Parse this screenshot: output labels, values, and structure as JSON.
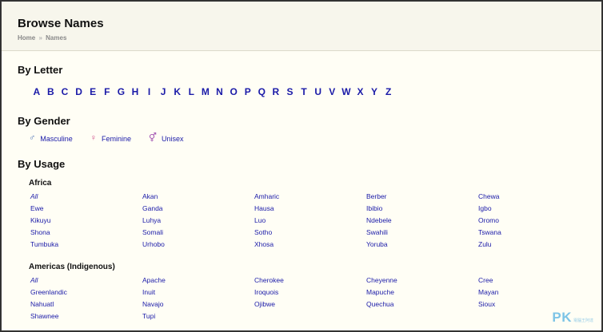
{
  "header": {
    "title": "Browse Names",
    "breadcrumb": [
      "Home",
      "Names"
    ],
    "breadcrumb_sep": "»"
  },
  "by_letter": {
    "heading": "By Letter",
    "letters": [
      "A",
      "B",
      "C",
      "D",
      "E",
      "F",
      "G",
      "H",
      "I",
      "J",
      "K",
      "L",
      "M",
      "N",
      "O",
      "P",
      "Q",
      "R",
      "S",
      "T",
      "U",
      "V",
      "W",
      "X",
      "Y",
      "Z"
    ]
  },
  "by_gender": {
    "heading": "By Gender",
    "items": [
      {
        "icon": "masculine-icon",
        "glyph": "♂",
        "label": "Masculine"
      },
      {
        "icon": "feminine-icon",
        "glyph": "♀",
        "label": "Feminine"
      },
      {
        "icon": "unisex-icon",
        "glyph": "⚥",
        "label": "Unisex"
      }
    ]
  },
  "by_usage": {
    "heading": "By Usage",
    "groups": [
      {
        "name": "Africa",
        "items": [
          "All",
          "Akan",
          "Amharic",
          "Berber",
          "Chewa",
          "Ewe",
          "Ganda",
          "Hausa",
          "Ibibio",
          "Igbo",
          "Kikuyu",
          "Luhya",
          "Luo",
          "Ndebele",
          "Oromo",
          "Shona",
          "Somali",
          "Sotho",
          "Swahili",
          "Tswana",
          "Tumbuka",
          "Urhobo",
          "Xhosa",
          "Yoruba",
          "Zulu"
        ]
      },
      {
        "name": "Americas (Indigenous)",
        "items": [
          "All",
          "Apache",
          "Cherokee",
          "Cheyenne",
          "Cree",
          "Greenlandic",
          "Inuit",
          "Iroquois",
          "Mapuche",
          "Mayan",
          "Nahuatl",
          "Navajo",
          "Ojibwe",
          "Quechua",
          "Sioux",
          "Shawnee",
          "Tupi"
        ]
      }
    ]
  },
  "watermark": {
    "main": "PK",
    "sub": "電腦王阿達"
  },
  "colors": {
    "link": "#1a1aa8",
    "background": "#fffef5",
    "masculine": "#4a6fb5",
    "feminine": "#d0508a",
    "unisex": "#a050b0"
  }
}
